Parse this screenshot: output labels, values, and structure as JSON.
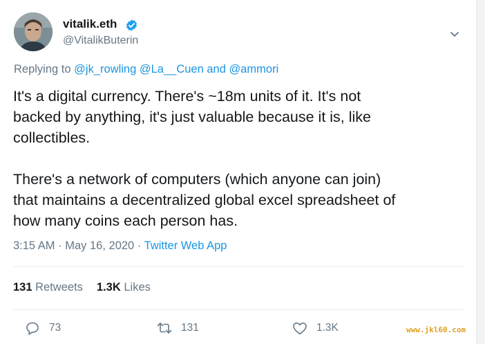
{
  "author": {
    "display_name": "vitalik.eth",
    "handle": "@VitalikButerin"
  },
  "reply_context": {
    "prefix": "Replying to",
    "mention1": "@jk_rowling",
    "mention2": "@La__Cuen",
    "conjunction": "and",
    "mention3": "@ammori"
  },
  "tweet": {
    "paragraph1_lines": [
      "It's a digital currency. There's ~18m units of it. It's not",
      "backed by anything, it's just valuable because it is, like",
      "collectibles."
    ],
    "paragraph2_lines": [
      "There's a network of computers (which anyone can join)",
      "that maintains a decentralized global excel spreadsheet of",
      "how many coins each person has."
    ]
  },
  "meta": {
    "time": "3:15 AM",
    "date": "May 16, 2020",
    "separator": "·",
    "source": "Twitter Web App"
  },
  "stats": {
    "retweets_count": "131",
    "retweets_label": "Retweets",
    "likes_count": "1.3K",
    "likes_label": "Likes"
  },
  "actions": {
    "replies": "73",
    "retweets": "131",
    "likes": "1.3K"
  },
  "watermark": "www.jkl60.com",
  "colors": {
    "link": "#1b95e0",
    "verified": "#1da1f2",
    "secondary_text": "#657786",
    "primary_text": "#14171a",
    "divider": "#e6ecf0"
  },
  "icons": [
    "verified-badge-icon",
    "chevron-down-icon",
    "reply-icon",
    "retweet-icon",
    "like-icon"
  ]
}
